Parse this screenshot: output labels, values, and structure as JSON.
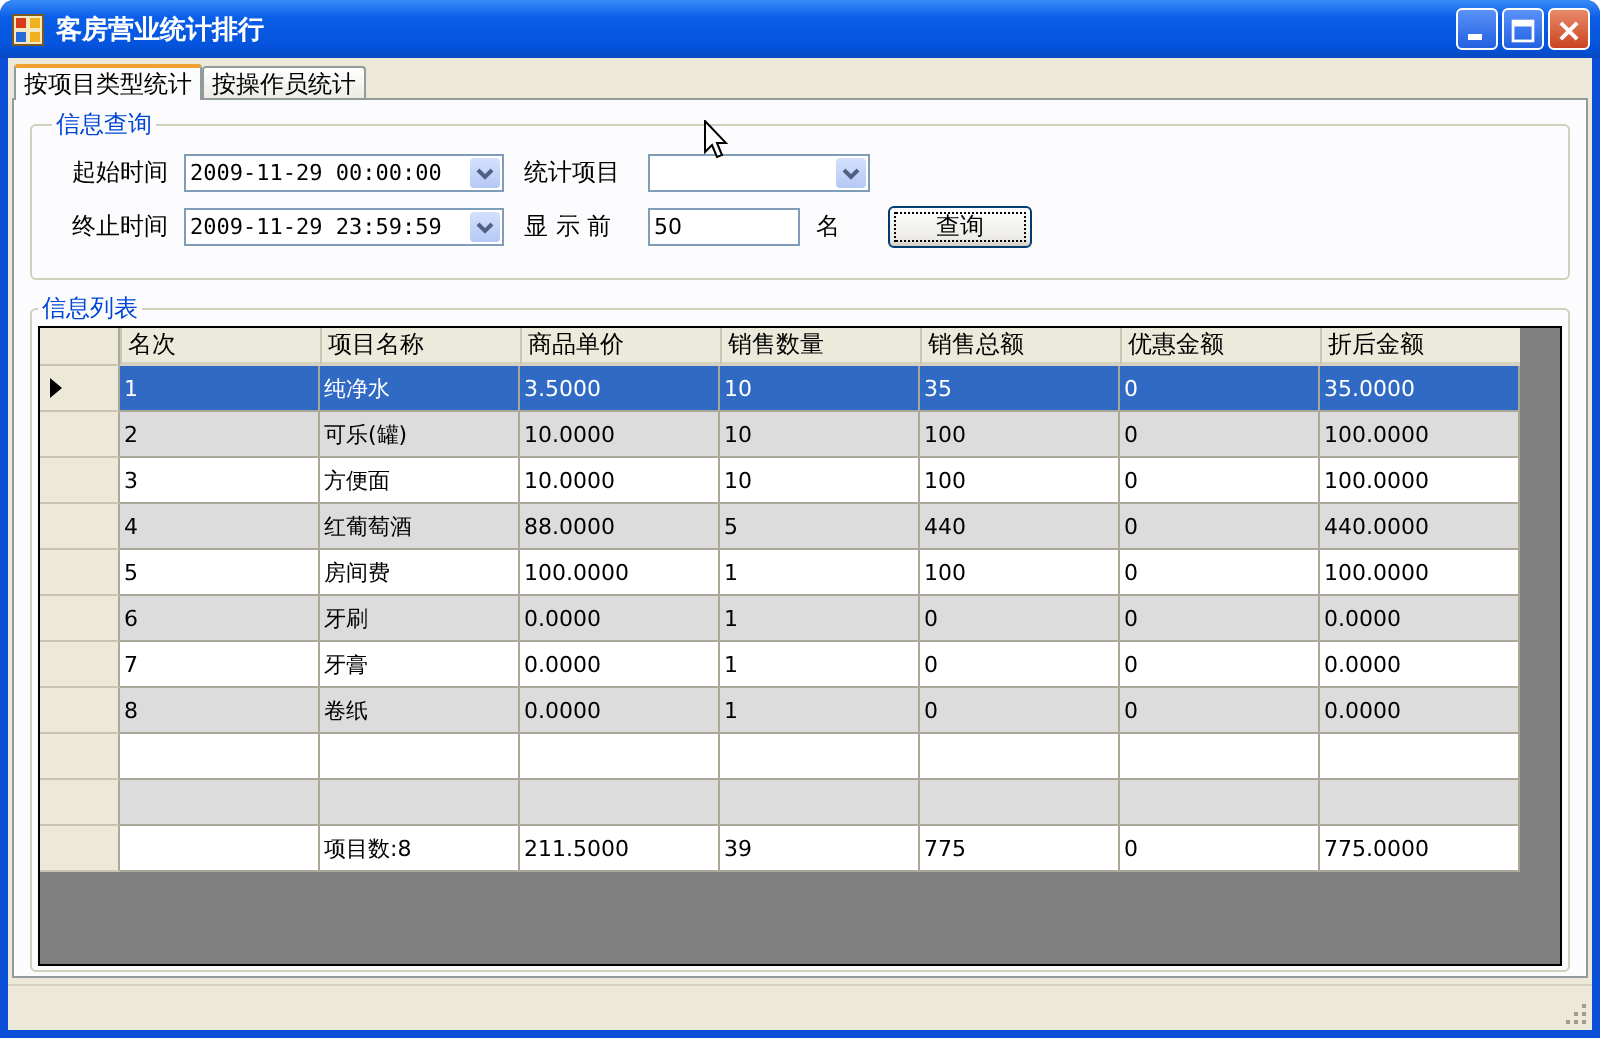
{
  "window": {
    "title": "客房营业统计排行"
  },
  "tabs": [
    {
      "label": "按项目类型统计",
      "selected": true
    },
    {
      "label": "按操作员统计",
      "selected": false
    }
  ],
  "query": {
    "title": "信息查询",
    "start_label": "起始时间",
    "start_value": "2009-11-29 00:00:00",
    "end_label": "终止时间",
    "end_value": "2009-11-29 23:59:59",
    "item_label": "统计项目",
    "show_label": "显 示 前",
    "show_value": "50",
    "show_suffix": "名",
    "button": "查询"
  },
  "list": {
    "title": "信息列表",
    "columns": [
      "名次",
      "项目名称",
      "商品单价",
      "销售数量",
      "销售总额",
      "优惠金额",
      "折后金额"
    ],
    "rows": [
      {
        "kind": "data",
        "selected": true,
        "cells": [
          "1",
          "纯净水",
          "3.5000",
          "10",
          "35",
          "0",
          "35.0000"
        ]
      },
      {
        "kind": "data",
        "selected": false,
        "cells": [
          "2",
          "可乐(罐)",
          "10.0000",
          "10",
          "100",
          "0",
          "100.0000"
        ]
      },
      {
        "kind": "data",
        "selected": false,
        "cells": [
          "3",
          "方便面",
          "10.0000",
          "10",
          "100",
          "0",
          "100.0000"
        ]
      },
      {
        "kind": "data",
        "selected": false,
        "cells": [
          "4",
          "红葡萄酒",
          "88.0000",
          "5",
          "440",
          "0",
          "440.0000"
        ]
      },
      {
        "kind": "data",
        "selected": false,
        "cells": [
          "5",
          "房间费",
          "100.0000",
          "1",
          "100",
          "0",
          "100.0000"
        ]
      },
      {
        "kind": "data",
        "selected": false,
        "cells": [
          "6",
          "牙刷",
          "0.0000",
          "1",
          "0",
          "0",
          "0.0000"
        ]
      },
      {
        "kind": "data",
        "selected": false,
        "cells": [
          "7",
          "牙膏",
          "0.0000",
          "1",
          "0",
          "0",
          "0.0000"
        ]
      },
      {
        "kind": "data",
        "selected": false,
        "cells": [
          "8",
          "卷纸",
          "0.0000",
          "1",
          "0",
          "0",
          "0.0000"
        ]
      },
      {
        "kind": "blank",
        "selected": false
      },
      {
        "kind": "blank",
        "selected": false
      },
      {
        "kind": "total",
        "selected": false,
        "cells": [
          "项目数:8",
          "211.5000",
          "39",
          "775",
          "0",
          "775.0000"
        ]
      }
    ]
  }
}
